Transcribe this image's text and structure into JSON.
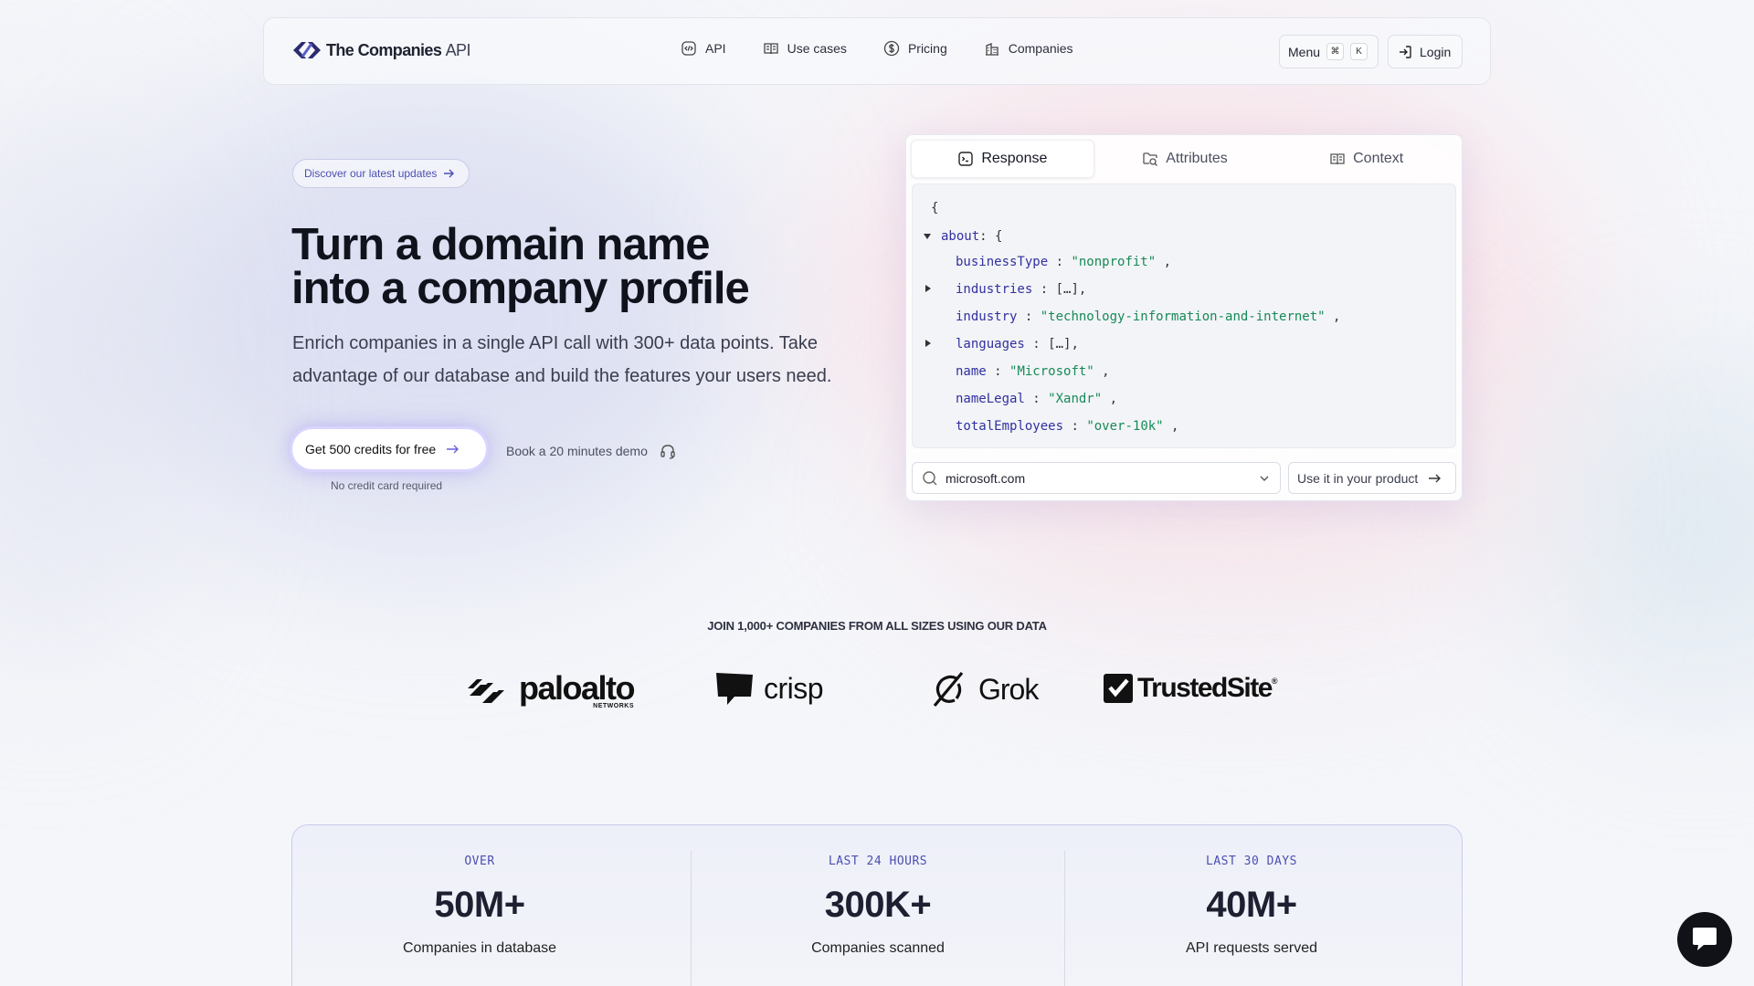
{
  "nav": {
    "logo_brand": "The Companies",
    "logo_api": "API",
    "links": [
      {
        "label": "API",
        "icon": "code-icon"
      },
      {
        "label": "Use cases",
        "icon": "book-icon"
      },
      {
        "label": "Pricing",
        "icon": "dollar-icon"
      },
      {
        "label": "Companies",
        "icon": "building-icon"
      }
    ],
    "menu_label": "Menu",
    "menu_kbd_1": "⌘",
    "menu_kbd_2": "K",
    "login_label": "Login"
  },
  "hero": {
    "pill": "Discover our latest updates",
    "title_line1": "Turn a domain name",
    "title_line2": "into a company profile",
    "subtitle": "Enrich companies in a single API call with 300+ data points. Take advantage of our database and build the features your users need.",
    "cta": "Get 500 credits for free",
    "cta_note": "No credit card required",
    "demo": "Book a 20 minutes demo"
  },
  "panel": {
    "tabs": [
      "Response",
      "Attributes",
      "Context"
    ],
    "active_tab": "Response",
    "json": {
      "open": "{",
      "about_key": "about",
      "about_open": ": {",
      "lines": [
        {
          "key": "businessType",
          "value": "\"nonprofit\"",
          "suffix": " ,"
        },
        {
          "key": "industries",
          "value": "[…],",
          "collapsed": true
        },
        {
          "key": "industry",
          "value": "\"technology-information-and-internet\"",
          "suffix": " ,"
        },
        {
          "key": "languages",
          "value": "[…],",
          "collapsed": true
        },
        {
          "key": "name",
          "value": "\"Microsoft\"",
          "suffix": " ,"
        },
        {
          "key": "nameLegal",
          "value": "\"Xandr\"",
          "suffix": " ,"
        },
        {
          "key": "totalEmployees",
          "value": "\"over-10k\"",
          "suffix": " ,"
        }
      ]
    },
    "domain_value": "microsoft.com",
    "use_button": "Use it in your product"
  },
  "logos": {
    "heading": "JOIN 1,000+ COMPANIES FROM ALL SIZES USING OUR DATA",
    "items": [
      {
        "name": "paloalto",
        "sub": "NETWORKS"
      },
      {
        "name": "crisp"
      },
      {
        "name": "Grok"
      },
      {
        "name": "TrustedSite"
      }
    ]
  },
  "stats": [
    {
      "label": "OVER",
      "value": "50M+",
      "desc": "Companies in database"
    },
    {
      "label": "LAST 24 HOURS",
      "value": "300K+",
      "desc": "Companies scanned"
    },
    {
      "label": "LAST 30 DAYS",
      "value": "40M+",
      "desc": "API requests served"
    }
  ],
  "colors": {
    "accent": "#4b4fb0",
    "json_key": "#3130a0",
    "json_string": "#168a57"
  }
}
